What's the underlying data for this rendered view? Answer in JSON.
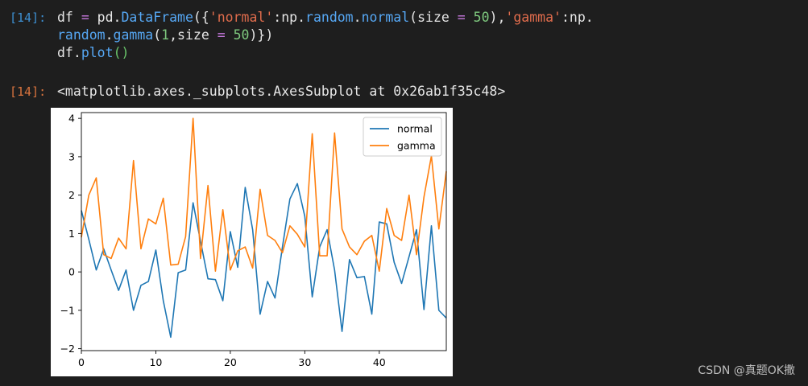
{
  "cell": {
    "in_prompt": "[14]:",
    "out_prompt": "[14]:",
    "code": {
      "t1": "df ",
      "t2": "=",
      "t3": " pd.",
      "t4": "DataFrame",
      "t5": "({",
      "t6": "'normal'",
      "t7": ":np.",
      "t8": "random",
      "t9": ".",
      "t10": "normal",
      "t11": "(size ",
      "t12": "=",
      "t13": " ",
      "t14": "50",
      "t15": "),",
      "t16": "'gamma'",
      "t17": ":np.",
      "t18": "random",
      "t19": ".",
      "t20": "gamma",
      "t21": "(",
      "t22": "1",
      "t23": ",size ",
      "t24": "=",
      "t25": " ",
      "t26": "50",
      "t27": ")})",
      "t28": "df.",
      "t29": "plot",
      "t30": "()"
    },
    "output_text": "<matplotlib.axes._subplots.AxesSubplot at 0x26ab1f35c48>"
  },
  "colors": {
    "normal": "#1f77b4",
    "gamma": "#ff7f0e"
  },
  "chart_data": {
    "type": "line",
    "x": [
      0,
      1,
      2,
      3,
      4,
      5,
      6,
      7,
      8,
      9,
      10,
      11,
      12,
      13,
      14,
      15,
      16,
      17,
      18,
      19,
      20,
      21,
      22,
      23,
      24,
      25,
      26,
      27,
      28,
      29,
      30,
      31,
      32,
      33,
      34,
      35,
      36,
      37,
      38,
      39,
      40,
      41,
      42,
      43,
      44,
      45,
      46,
      47,
      48,
      49
    ],
    "xlim": [
      0,
      49
    ],
    "ylim": [
      -2.05,
      4.15
    ],
    "xticks": [
      0,
      10,
      20,
      30,
      40
    ],
    "yticks": [
      -2,
      -1,
      0,
      1,
      2,
      3,
      4
    ],
    "legend_position": "top-right",
    "grid": false,
    "series": [
      {
        "name": "normal",
        "values": [
          1.6,
          0.85,
          0.05,
          0.6,
          0.05,
          -0.48,
          0.05,
          -1.0,
          -0.35,
          -0.25,
          0.57,
          -0.75,
          -1.7,
          -0.02,
          0.05,
          1.8,
          0.8,
          -0.18,
          -0.2,
          -0.75,
          1.05,
          0.12,
          2.2,
          1.1,
          -1.1,
          -0.25,
          -0.68,
          0.65,
          1.9,
          2.3,
          1.45,
          -0.65,
          0.65,
          1.1,
          0.05,
          -1.55,
          0.32,
          -0.15,
          -0.12,
          -1.1,
          1.3,
          1.25,
          0.25,
          -0.3,
          0.4,
          1.1,
          -0.98,
          1.2,
          -1.0,
          -1.2
        ]
      },
      {
        "name": "gamma",
        "values": [
          0.9,
          2.0,
          2.45,
          0.45,
          0.35,
          0.88,
          0.6,
          2.9,
          0.6,
          1.38,
          1.25,
          1.92,
          0.18,
          0.2,
          0.92,
          4.0,
          0.35,
          2.25,
          0.02,
          1.62,
          0.05,
          0.55,
          0.65,
          0.1,
          2.15,
          0.95,
          0.82,
          0.5,
          1.2,
          0.98,
          0.65,
          3.6,
          0.42,
          0.42,
          3.62,
          1.12,
          0.65,
          0.45,
          0.8,
          0.95,
          0.02,
          1.65,
          0.95,
          0.82,
          2.0,
          0.45,
          1.95,
          3.02,
          1.12,
          2.62
        ]
      }
    ]
  },
  "watermark": "CSDN @真题OK撒"
}
